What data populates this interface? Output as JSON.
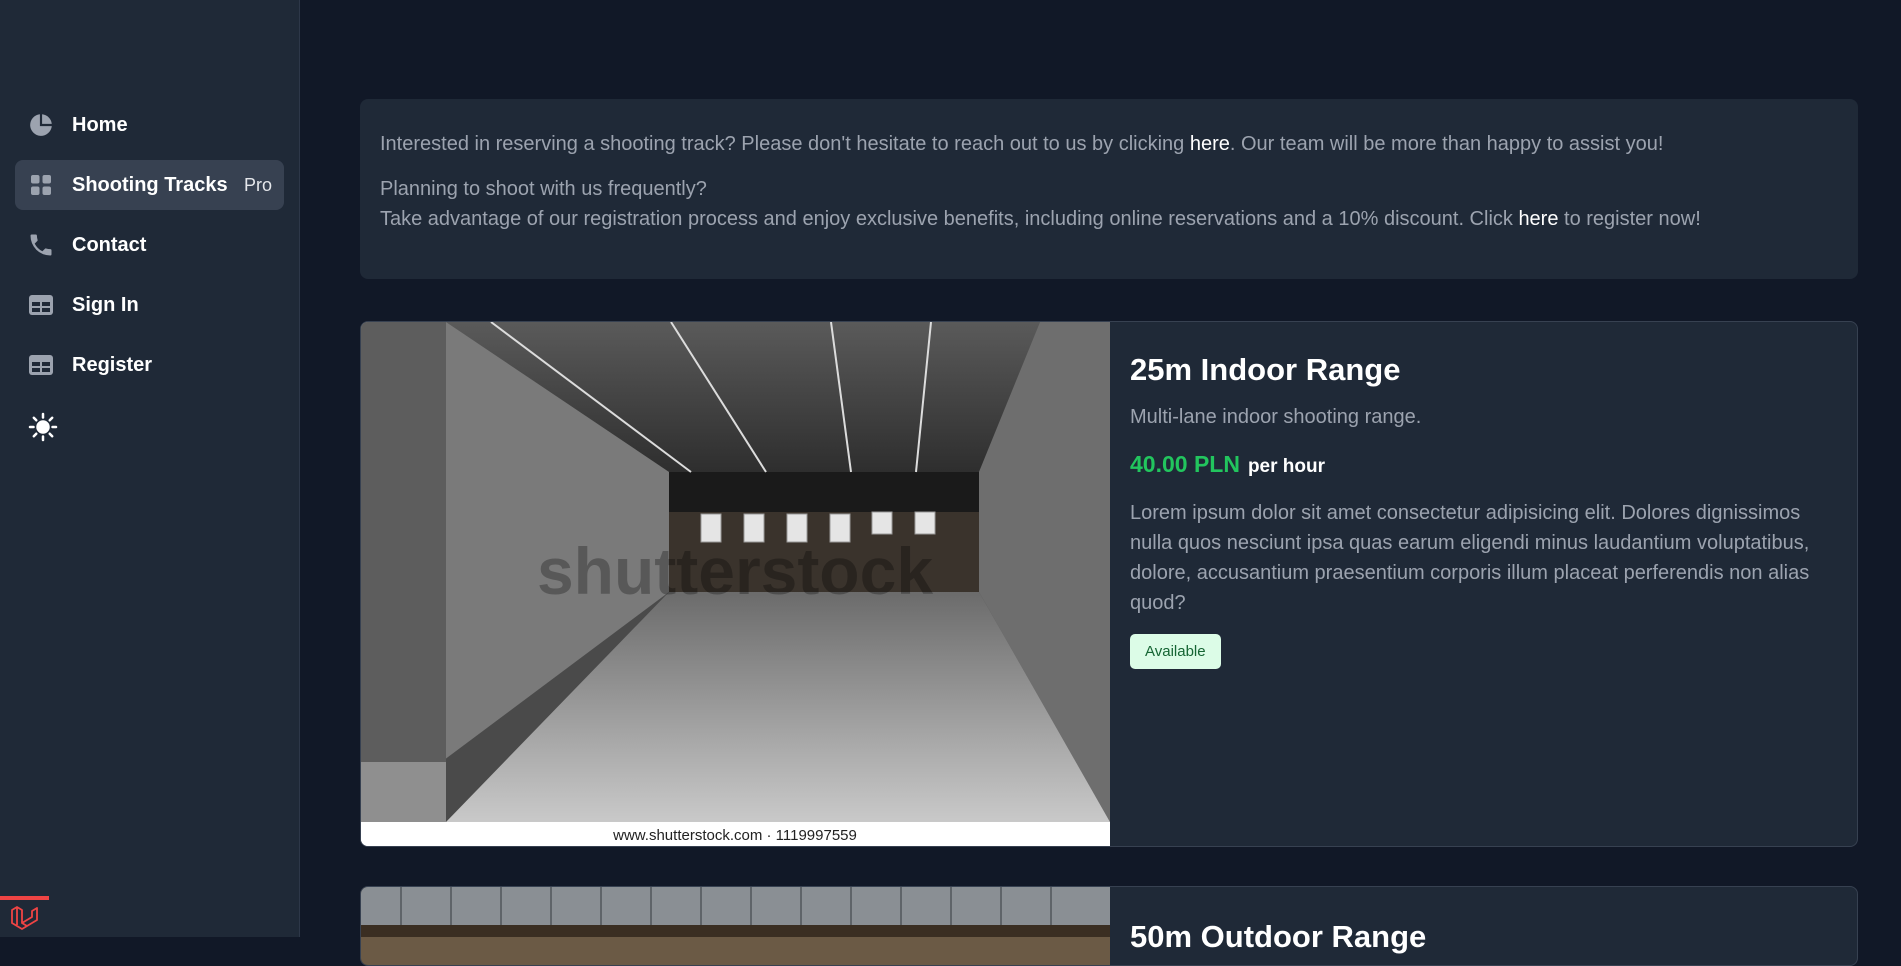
{
  "sidebar": {
    "items": [
      {
        "label": "Home",
        "icon": "pie-chart-icon",
        "active": false
      },
      {
        "label": "Shooting Tracks",
        "icon": "grid-icon",
        "active": true,
        "badge": "Pro"
      },
      {
        "label": "Contact",
        "icon": "phone-icon",
        "active": false
      },
      {
        "label": "Sign In",
        "icon": "table-icon",
        "active": false
      },
      {
        "label": "Register",
        "icon": "table-icon",
        "active": false
      }
    ],
    "theme_toggle_icon": "sun-icon",
    "footer_logo_icon": "laravel-logo-icon"
  },
  "info": {
    "line1_pre": "Interested in reserving a shooting track? Please don't hesitate to reach out to us by clicking ",
    "line1_link": "here",
    "line1_post": ". Our team will be more than happy to assist you!",
    "line2": "Planning to shoot with us frequently?",
    "line3_pre": "Take advantage of our registration process and enjoy exclusive benefits, including online reservations and a 10% discount. Click ",
    "line3_link": "here",
    "line3_post": " to register now!"
  },
  "tracks": [
    {
      "name": "25m Indoor Range",
      "subtitle": "Multi-lane indoor shooting range.",
      "price": "40.00 PLN",
      "price_unit": "per hour",
      "description": "Lorem ipsum dolor sit amet consectetur adipisicing elit. Dolores dignissimos nulla quos nesciunt ipsa quas earum eligendi minus laudantium voluptatibus, dolore, accusantium praesentium corporis illum placeat perferendis non alias quod?",
      "status": "Available",
      "image_watermark": "shutterstock",
      "image_caption": "www.shutterstock.com · 1119997559"
    },
    {
      "name": "50m Outdoor Range"
    }
  ],
  "colors": {
    "background": "#111827",
    "panel": "#1f2937",
    "price": "#22c55e",
    "badge_bg": "#dcfce7",
    "badge_text": "#166534"
  }
}
